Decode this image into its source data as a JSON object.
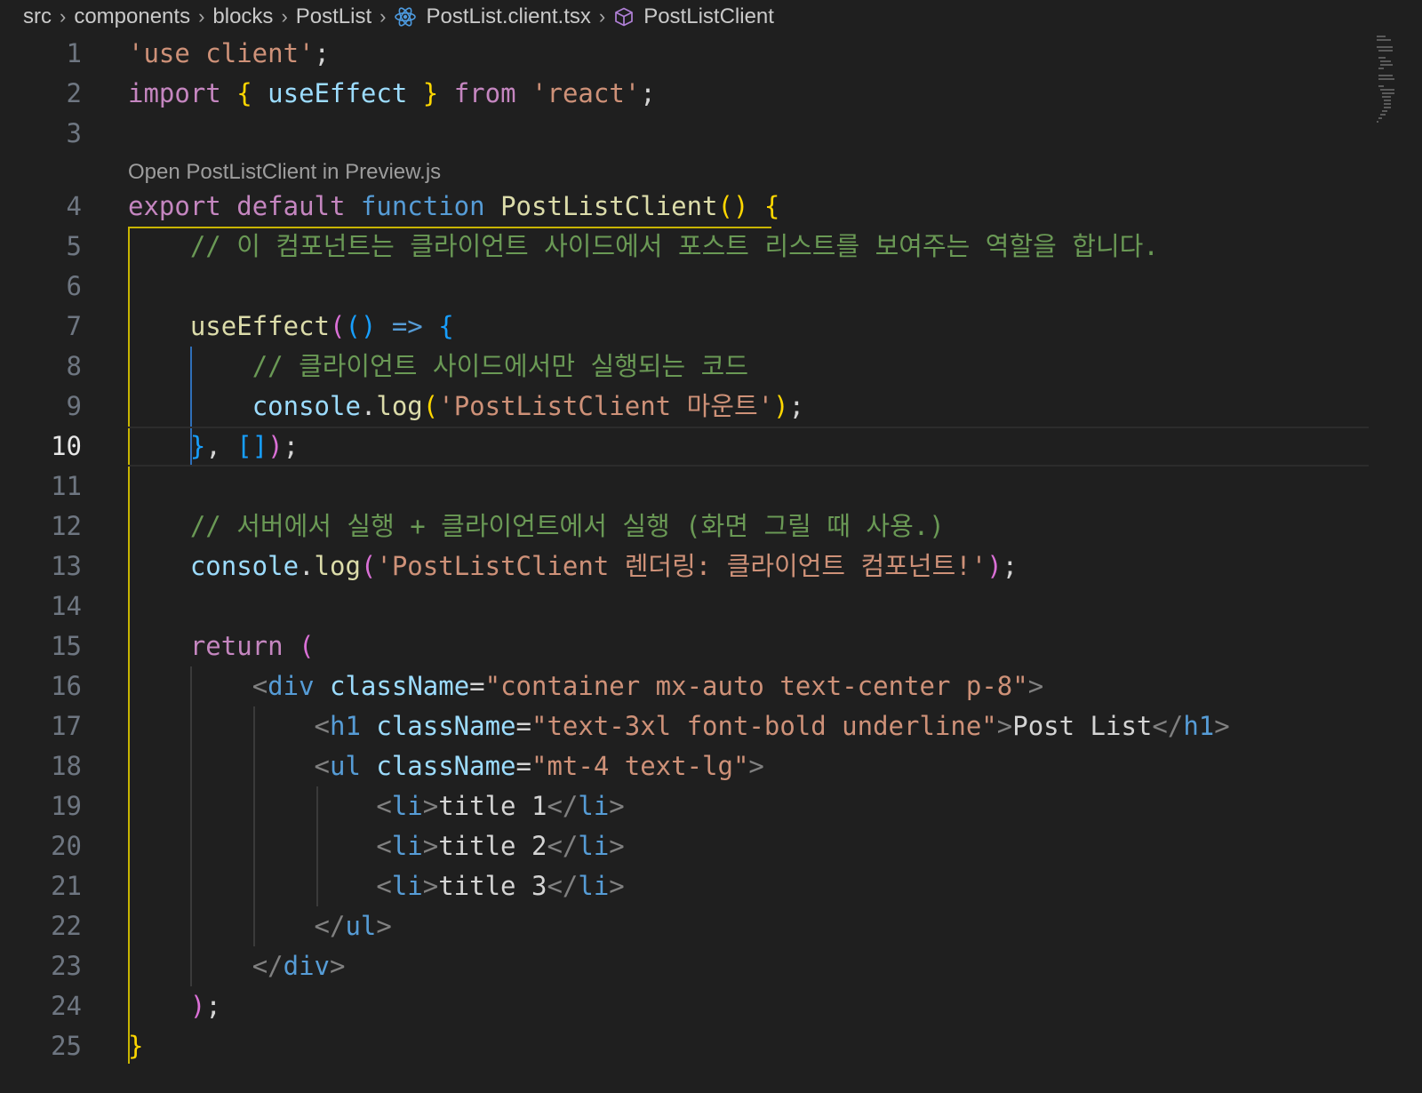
{
  "breadcrumb": {
    "items": [
      {
        "label": "src",
        "icon": ""
      },
      {
        "label": "components",
        "icon": ""
      },
      {
        "label": "blocks",
        "icon": ""
      },
      {
        "label": "PostList",
        "icon": ""
      },
      {
        "label": "PostList.client.tsx",
        "icon": "react-icon"
      },
      {
        "label": "PostListClient",
        "icon": "symbol-cube-icon"
      }
    ]
  },
  "editor": {
    "active_line": 10,
    "codelens": "Open PostListClient in Preview.js",
    "line_numbers": [
      "1",
      "2",
      "3",
      "4",
      "5",
      "6",
      "7",
      "8",
      "9",
      "10",
      "11",
      "12",
      "13",
      "14",
      "15",
      "16",
      "17",
      "18",
      "19",
      "20",
      "21",
      "22",
      "23",
      "24",
      "25"
    ],
    "lines": [
      [
        [
          "st",
          "'use client'"
        ],
        [
          "pu",
          ";"
        ]
      ],
      [
        [
          "kw",
          "import"
        ],
        [
          "pu",
          " "
        ],
        [
          "b1",
          "{"
        ],
        [
          "pu",
          " "
        ],
        [
          "vr",
          "useEffect"
        ],
        [
          "pu",
          " "
        ],
        [
          "b1",
          "}"
        ],
        [
          "pu",
          " "
        ],
        [
          "kw",
          "from"
        ],
        [
          "pu",
          " "
        ],
        [
          "st",
          "'react'"
        ],
        [
          "pu",
          ";"
        ]
      ],
      [],
      [
        [
          "kw",
          "export"
        ],
        [
          "pu",
          " "
        ],
        [
          "kw",
          "default"
        ],
        [
          "pu",
          " "
        ],
        [
          "sb",
          "function"
        ],
        [
          "pu",
          " "
        ],
        [
          "fn",
          "PostListClient"
        ],
        [
          "b1",
          "()"
        ],
        [
          "pu",
          " "
        ],
        [
          "b1",
          "{"
        ]
      ],
      [
        [
          "pu",
          "    "
        ],
        [
          "cm",
          "// 이 컴포넌트는 클라이언트 사이드에서 포스트 리스트를 보여주는 역할을 합니다."
        ]
      ],
      [],
      [
        [
          "pu",
          "    "
        ],
        [
          "fn",
          "useEffect"
        ],
        [
          "b2",
          "("
        ],
        [
          "b3",
          "()"
        ],
        [
          "pu",
          " "
        ],
        [
          "sb",
          "=>"
        ],
        [
          "pu",
          " "
        ],
        [
          "b3",
          "{"
        ]
      ],
      [
        [
          "pu",
          "        "
        ],
        [
          "cm",
          "// 클라이언트 사이드에서만 실행되는 코드"
        ]
      ],
      [
        [
          "pu",
          "        "
        ],
        [
          "vr",
          "console"
        ],
        [
          "pu",
          "."
        ],
        [
          "fn",
          "log"
        ],
        [
          "b1",
          "("
        ],
        [
          "st",
          "'PostListClient 마운트'"
        ],
        [
          "b1",
          ")"
        ],
        [
          "pu",
          ";"
        ]
      ],
      [
        [
          "pu",
          "    "
        ],
        [
          "b3",
          "}"
        ],
        [
          "pu",
          ", "
        ],
        [
          "b3",
          "[]"
        ],
        [
          "b2",
          ")"
        ],
        [
          "pu",
          ";"
        ]
      ],
      [],
      [
        [
          "pu",
          "    "
        ],
        [
          "cm",
          "// 서버에서 실행 + 클라이언트에서 실행 (화면 그릴 때 사용.)"
        ]
      ],
      [
        [
          "pu",
          "    "
        ],
        [
          "vr",
          "console"
        ],
        [
          "pu",
          "."
        ],
        [
          "fn",
          "log"
        ],
        [
          "b2",
          "("
        ],
        [
          "st",
          "'PostListClient 렌더링: 클라이언트 컴포넌트!'"
        ],
        [
          "b2",
          ")"
        ],
        [
          "pu",
          ";"
        ]
      ],
      [],
      [
        [
          "pu",
          "    "
        ],
        [
          "kw",
          "return"
        ],
        [
          "pu",
          " "
        ],
        [
          "b2",
          "("
        ]
      ],
      [
        [
          "pu",
          "        "
        ],
        [
          "ang",
          "<"
        ],
        [
          "tg",
          "div"
        ],
        [
          "pu",
          " "
        ],
        [
          "at",
          "className"
        ],
        [
          "pu",
          "="
        ],
        [
          "st",
          "\"container mx-auto text-center p-8\""
        ],
        [
          "ang",
          ">"
        ]
      ],
      [
        [
          "pu",
          "            "
        ],
        [
          "ang",
          "<"
        ],
        [
          "tg",
          "h1"
        ],
        [
          "pu",
          " "
        ],
        [
          "at",
          "className"
        ],
        [
          "pu",
          "="
        ],
        [
          "st",
          "\"text-3xl font-bold underline\""
        ],
        [
          "ang",
          ">"
        ],
        [
          "pu",
          "Post List"
        ],
        [
          "ang",
          "</"
        ],
        [
          "tg",
          "h1"
        ],
        [
          "ang",
          ">"
        ]
      ],
      [
        [
          "pu",
          "            "
        ],
        [
          "ang",
          "<"
        ],
        [
          "tg",
          "ul"
        ],
        [
          "pu",
          " "
        ],
        [
          "at",
          "className"
        ],
        [
          "pu",
          "="
        ],
        [
          "st",
          "\"mt-4 text-lg\""
        ],
        [
          "ang",
          ">"
        ]
      ],
      [
        [
          "pu",
          "                "
        ],
        [
          "ang",
          "<"
        ],
        [
          "tg",
          "li"
        ],
        [
          "ang",
          ">"
        ],
        [
          "pu",
          "title 1"
        ],
        [
          "ang",
          "</"
        ],
        [
          "tg",
          "li"
        ],
        [
          "ang",
          ">"
        ]
      ],
      [
        [
          "pu",
          "                "
        ],
        [
          "ang",
          "<"
        ],
        [
          "tg",
          "li"
        ],
        [
          "ang",
          ">"
        ],
        [
          "pu",
          "title 2"
        ],
        [
          "ang",
          "</"
        ],
        [
          "tg",
          "li"
        ],
        [
          "ang",
          ">"
        ]
      ],
      [
        [
          "pu",
          "                "
        ],
        [
          "ang",
          "<"
        ],
        [
          "tg",
          "li"
        ],
        [
          "ang",
          ">"
        ],
        [
          "pu",
          "title 3"
        ],
        [
          "ang",
          "</"
        ],
        [
          "tg",
          "li"
        ],
        [
          "ang",
          ">"
        ]
      ],
      [
        [
          "pu",
          "            "
        ],
        [
          "ang",
          "</"
        ],
        [
          "tg",
          "ul"
        ],
        [
          "ang",
          ">"
        ]
      ],
      [
        [
          "pu",
          "        "
        ],
        [
          "ang",
          "</"
        ],
        [
          "tg",
          "div"
        ],
        [
          "ang",
          ">"
        ]
      ],
      [
        [
          "pu",
          "    "
        ],
        [
          "b2",
          ")"
        ],
        [
          "pu",
          ";"
        ]
      ],
      [
        [
          "b1",
          "}"
        ]
      ]
    ]
  },
  "colors": {
    "background": "#1f1f1f",
    "keyword": "#c586c0",
    "string": "#ce9178",
    "function": "#dcdcaa",
    "variable": "#9cdcfe",
    "comment": "#6a9955",
    "tag": "#569cd6",
    "bracket_1": "#ffd700",
    "bracket_2": "#da70d6",
    "bracket_3": "#179fff"
  }
}
